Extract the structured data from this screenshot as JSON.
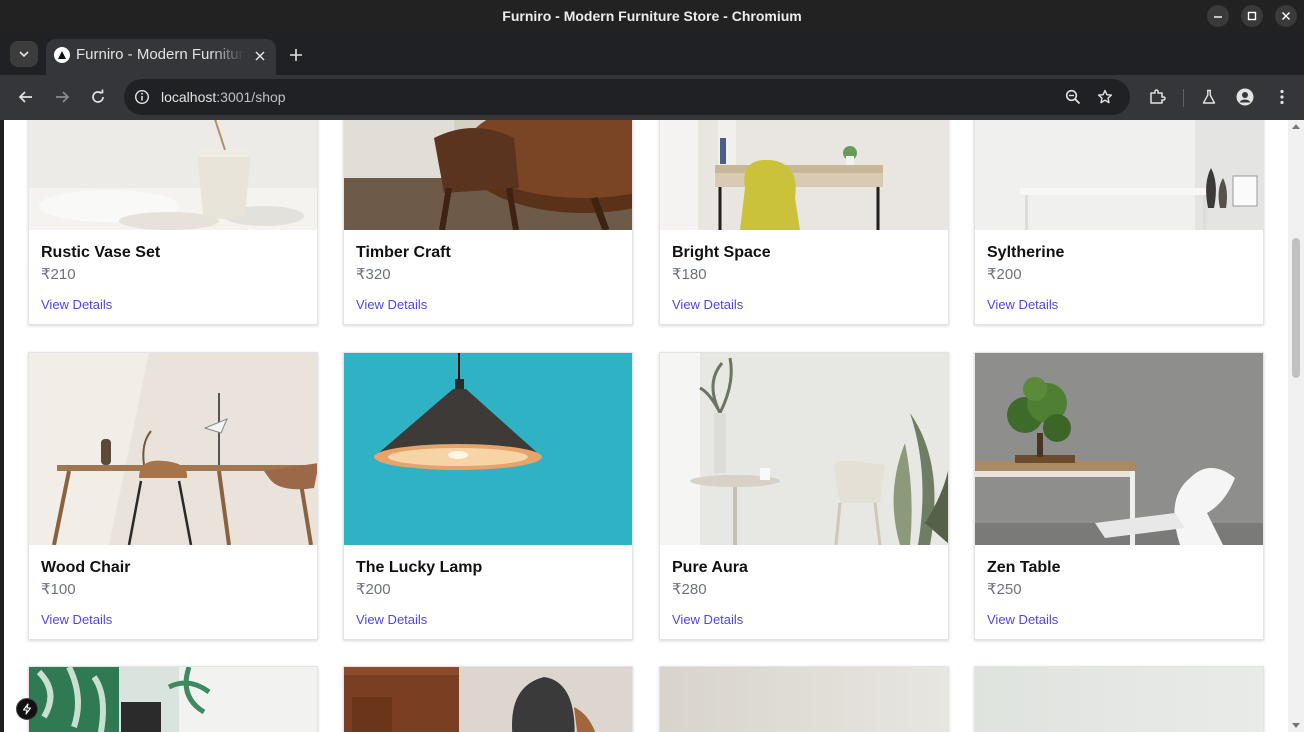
{
  "window": {
    "title": "Furniro - Modern Furniture Store - Chromium"
  },
  "tab": {
    "title": "Furniro - Modern Furniture Store"
  },
  "omnibox": {
    "host": "localhost",
    "path": ":3001/shop"
  },
  "products": [
    {
      "name": "Rustic Vase Set",
      "price": "₹210",
      "link": "View Details"
    },
    {
      "name": "Timber Craft",
      "price": "₹320",
      "link": "View Details"
    },
    {
      "name": "Bright Space",
      "price": "₹180",
      "link": "View Details"
    },
    {
      "name": "Syltherine",
      "price": "₹200",
      "link": "View Details"
    },
    {
      "name": "Wood Chair",
      "price": "₹100",
      "link": "View Details"
    },
    {
      "name": "The Lucky Lamp",
      "price": "₹200",
      "link": "View Details"
    },
    {
      "name": "Pure Aura",
      "price": "₹280",
      "link": "View Details"
    },
    {
      "name": "Zen Table",
      "price": "₹250",
      "link": "View Details"
    }
  ],
  "colors": {
    "link": "#4f46e5",
    "price": "#6b7280",
    "lamp_bg": "#2fb3c4"
  }
}
